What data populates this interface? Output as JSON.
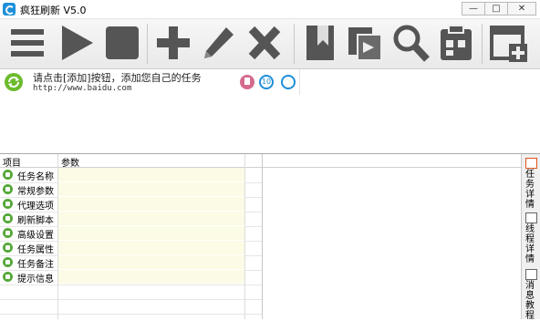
{
  "window": {
    "title": "疯狂刷新 V5.0",
    "controls": [
      "—",
      "□",
      "✕"
    ]
  },
  "toolbar": {
    "buttons": [
      {
        "name": "menu-button",
        "icon": "hamburger-icon"
      },
      {
        "name": "start-button",
        "icon": "play-icon"
      },
      {
        "name": "stop-button",
        "icon": "stop-icon"
      },
      {
        "name": "add-button",
        "icon": "plus-icon"
      },
      {
        "name": "edit-button",
        "icon": "pencil-icon"
      },
      {
        "name": "delete-button",
        "icon": "x-icon"
      },
      {
        "name": "bookmark-button",
        "icon": "bookmark-icon"
      },
      {
        "name": "import-button",
        "icon": "import-icon"
      },
      {
        "name": "search-button",
        "icon": "magnifier-icon"
      },
      {
        "name": "schedule-button",
        "icon": "clipboard-icon"
      },
      {
        "name": "add-window-button",
        "icon": "window-plus-icon"
      }
    ],
    "colors": {
      "icon": "#555555",
      "icon_dark": "#3c3c3c"
    }
  },
  "task": {
    "title": "请点击[添加]按钮，添加您自己的任务",
    "url": "http://www.baidu.com",
    "badge_count": "10"
  },
  "grid": {
    "headers": [
      "项目",
      "参数"
    ],
    "rows": [
      {
        "label": "任务名称",
        "color": "#55a838"
      },
      {
        "label": "常规参数",
        "color": "#55a838"
      },
      {
        "label": "代理选项",
        "color": "#55a838"
      },
      {
        "label": "刷新脚本",
        "color": "#55a838"
      },
      {
        "label": "高级设置",
        "color": "#55a838"
      },
      {
        "label": "任务属性",
        "color": "#55a838"
      },
      {
        "label": "任务备注",
        "color": "#55a838"
      },
      {
        "label": "提示信息",
        "color": "#55a838"
      }
    ]
  },
  "side_tabs": [
    {
      "label": "任务详情",
      "icon": "calendar-icon",
      "active": true
    },
    {
      "label": "线程详情",
      "icon": "window-icon",
      "active": false
    },
    {
      "label": "消息教程",
      "icon": "layout-icon",
      "active": false
    }
  ]
}
